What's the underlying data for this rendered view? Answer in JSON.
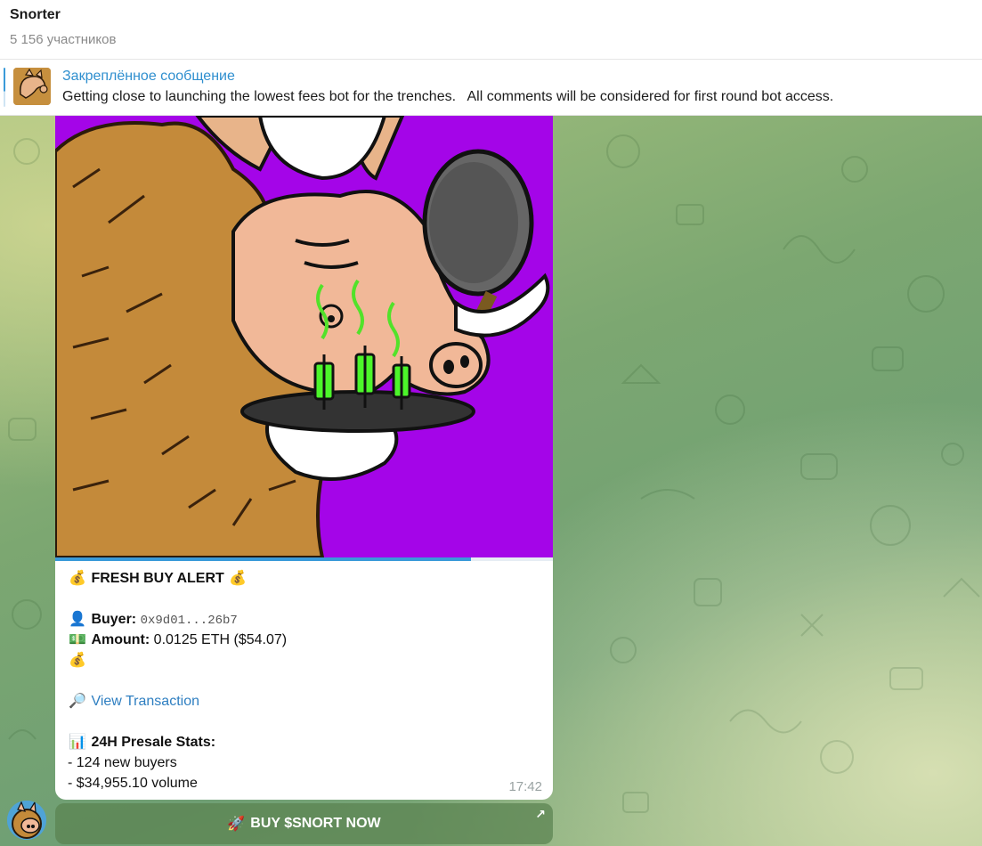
{
  "header": {
    "title": "Snorter",
    "subtitle": "5 156 участников"
  },
  "pinned": {
    "title": "Закреплённое сообщение",
    "text": "Getting close to launching the lowest fees bot for the trenches.   All comments will be considered for first round bot access."
  },
  "message": {
    "media_progress": 0.835,
    "alert_title": "FRESH BUY ALERT",
    "buyer_label": "Buyer:",
    "buyer_value": "0x9d01...26b7",
    "amount_label": "Amount:",
    "amount_value": "0.0125 ETH ($54.07)",
    "view_link": "View Transaction",
    "stats_title": "24H Presale Stats:",
    "stats_lines": [
      "- 124 new buyers",
      "- $34,955.10 volume"
    ],
    "time": "17:42",
    "emoji": {
      "money_bag": "💰",
      "bust": "👤",
      "money": "💵",
      "magnifier": "🔎",
      "chart": "📊",
      "rocket": "🚀"
    }
  },
  "button": {
    "label": "BUY $SNORT NOW"
  },
  "colors": {
    "accent": "#3a9ad9",
    "link": "#2f7fc1",
    "media_bg": "#a405e8"
  },
  "icons": [
    "pin-thumbnail",
    "sender-avatar",
    "external-link-icon"
  ]
}
